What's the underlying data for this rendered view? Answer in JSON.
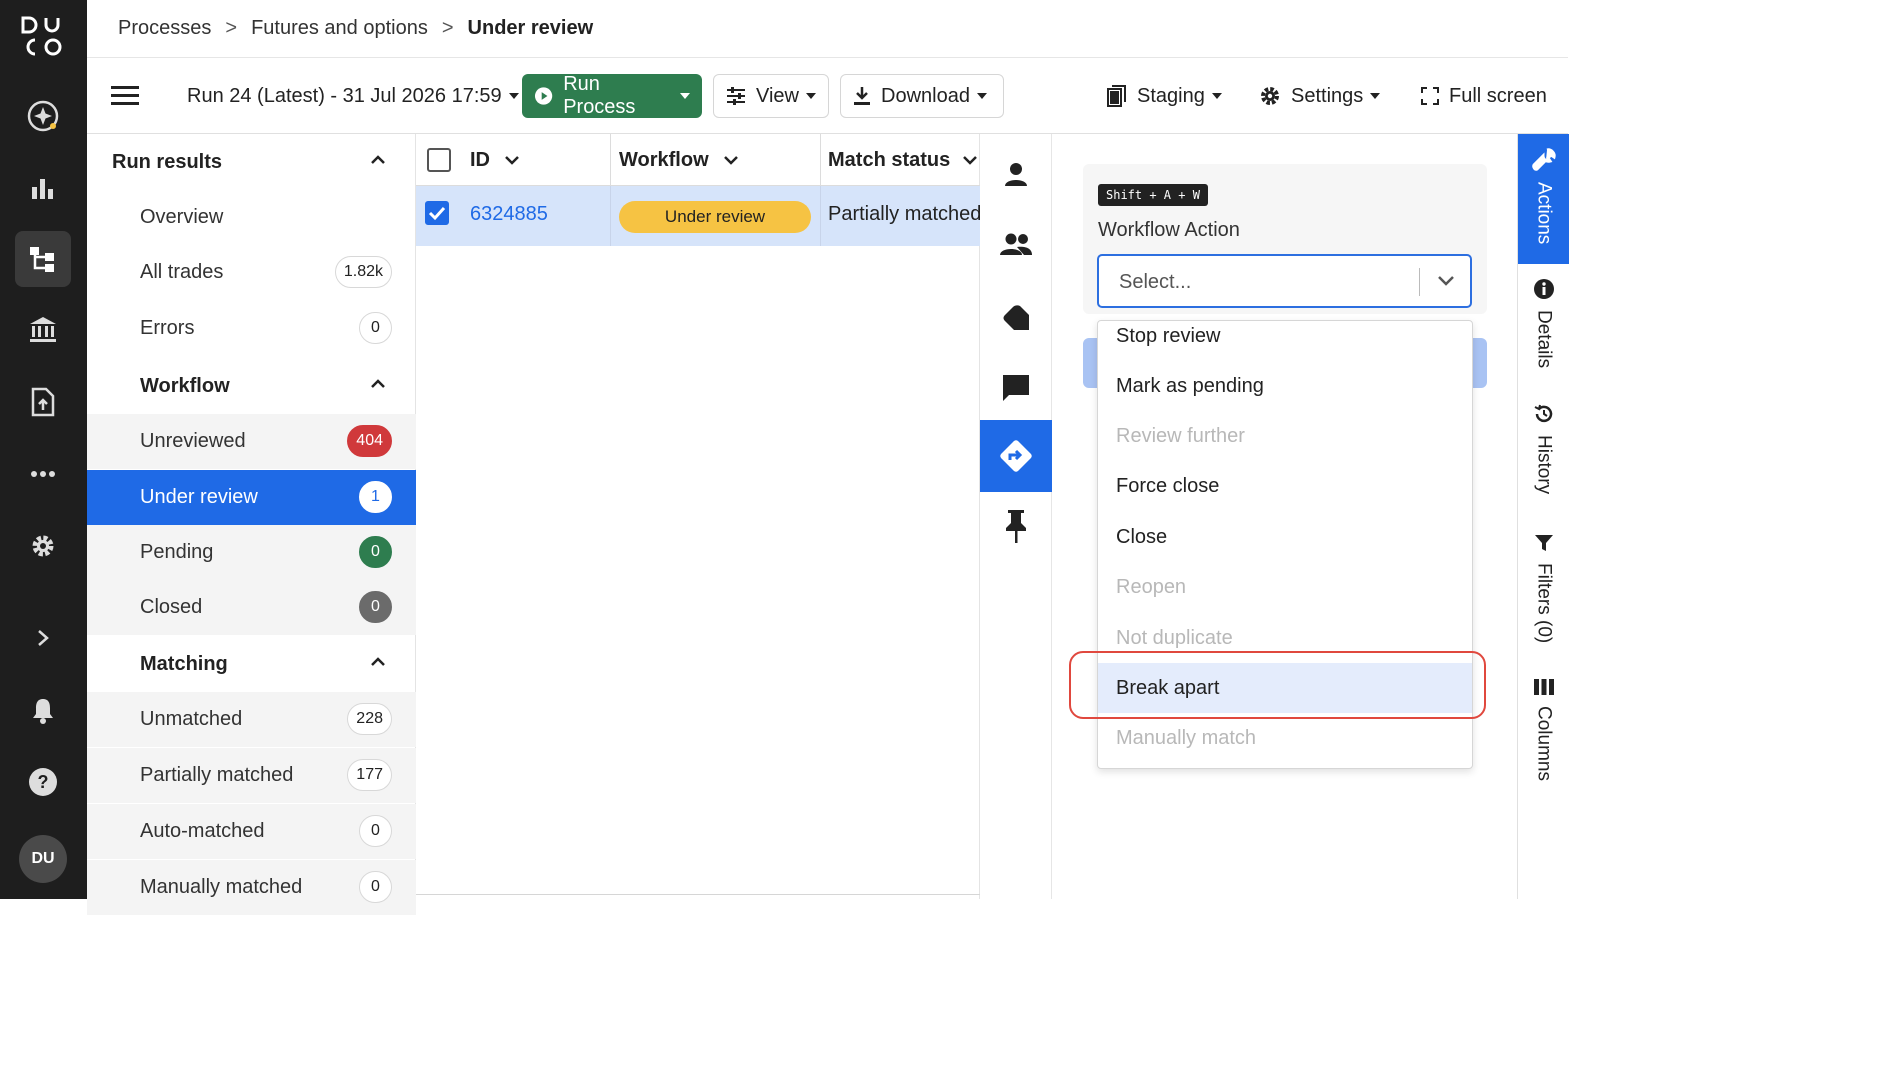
{
  "app": {
    "logo_text": "DUCO",
    "avatar": "DU"
  },
  "rail": {
    "items": [
      {
        "name": "ai-sparkle-icon"
      },
      {
        "name": "analytics-icon"
      },
      {
        "name": "processes-icon"
      },
      {
        "name": "bank-icon"
      },
      {
        "name": "upload-file-icon"
      },
      {
        "name": "more-icon"
      },
      {
        "name": "settings-gear-icon"
      },
      {
        "name": "expand-chevron-icon"
      },
      {
        "name": "notifications-bell-icon"
      },
      {
        "name": "help-icon"
      }
    ]
  },
  "breadcrumb": {
    "items": [
      "Processes",
      "Futures and options"
    ],
    "current": "Under review"
  },
  "toolbar": {
    "run_label": "Run 24 (Latest) - 31 Jul 2026 17:59",
    "run_process": "Run Process",
    "view": "View",
    "download": "Download",
    "staging": "Staging",
    "settings": "Settings",
    "fullscreen": "Full screen"
  },
  "sidebar": {
    "run_results": {
      "title": "Run results",
      "items": [
        {
          "label": "Overview"
        },
        {
          "label": "All trades",
          "count": "1.82k"
        },
        {
          "label": "Errors",
          "count": "0"
        }
      ]
    },
    "workflow": {
      "title": "Workflow",
      "items": [
        {
          "label": "Unreviewed",
          "count": "404"
        },
        {
          "label": "Under review",
          "count": "1"
        },
        {
          "label": "Pending",
          "count": "0"
        },
        {
          "label": "Closed",
          "count": "0"
        }
      ]
    },
    "matching": {
      "title": "Matching",
      "items": [
        {
          "label": "Unmatched",
          "count": "228"
        },
        {
          "label": "Partially matched",
          "count": "177"
        },
        {
          "label": "Auto-matched",
          "count": "0"
        },
        {
          "label": "Manually matched",
          "count": "0"
        }
      ]
    }
  },
  "grid": {
    "columns": [
      "ID",
      "Workflow",
      "Match status"
    ],
    "rows": [
      {
        "id": "6324885",
        "workflow": "Under review",
        "match_status": "Partially matched",
        "selected": true
      }
    ]
  },
  "panel": {
    "shortcut": "Shift + A + W",
    "label": "Workflow Action",
    "placeholder": "Select...",
    "options": [
      {
        "label": "Stop review",
        "disabled": false
      },
      {
        "label": "Mark as pending",
        "disabled": false
      },
      {
        "label": "Review further",
        "disabled": true
      },
      {
        "label": "Force close",
        "disabled": false
      },
      {
        "label": "Close",
        "disabled": false
      },
      {
        "label": "Reopen",
        "disabled": true
      },
      {
        "label": "Not duplicate",
        "disabled": true
      },
      {
        "label": "Break apart",
        "disabled": false,
        "highlighted": true
      },
      {
        "label": "Manually match",
        "disabled": true
      }
    ]
  },
  "right_tabs": [
    "Actions",
    "Details",
    "History",
    "Filters (0)",
    "Columns"
  ],
  "colors": {
    "primary": "#1f6ae6",
    "green": "#2e7d4f",
    "red_badge": "#d0393b",
    "pill_yellow": "#f6c343",
    "highlight_ring": "#e0483e"
  }
}
